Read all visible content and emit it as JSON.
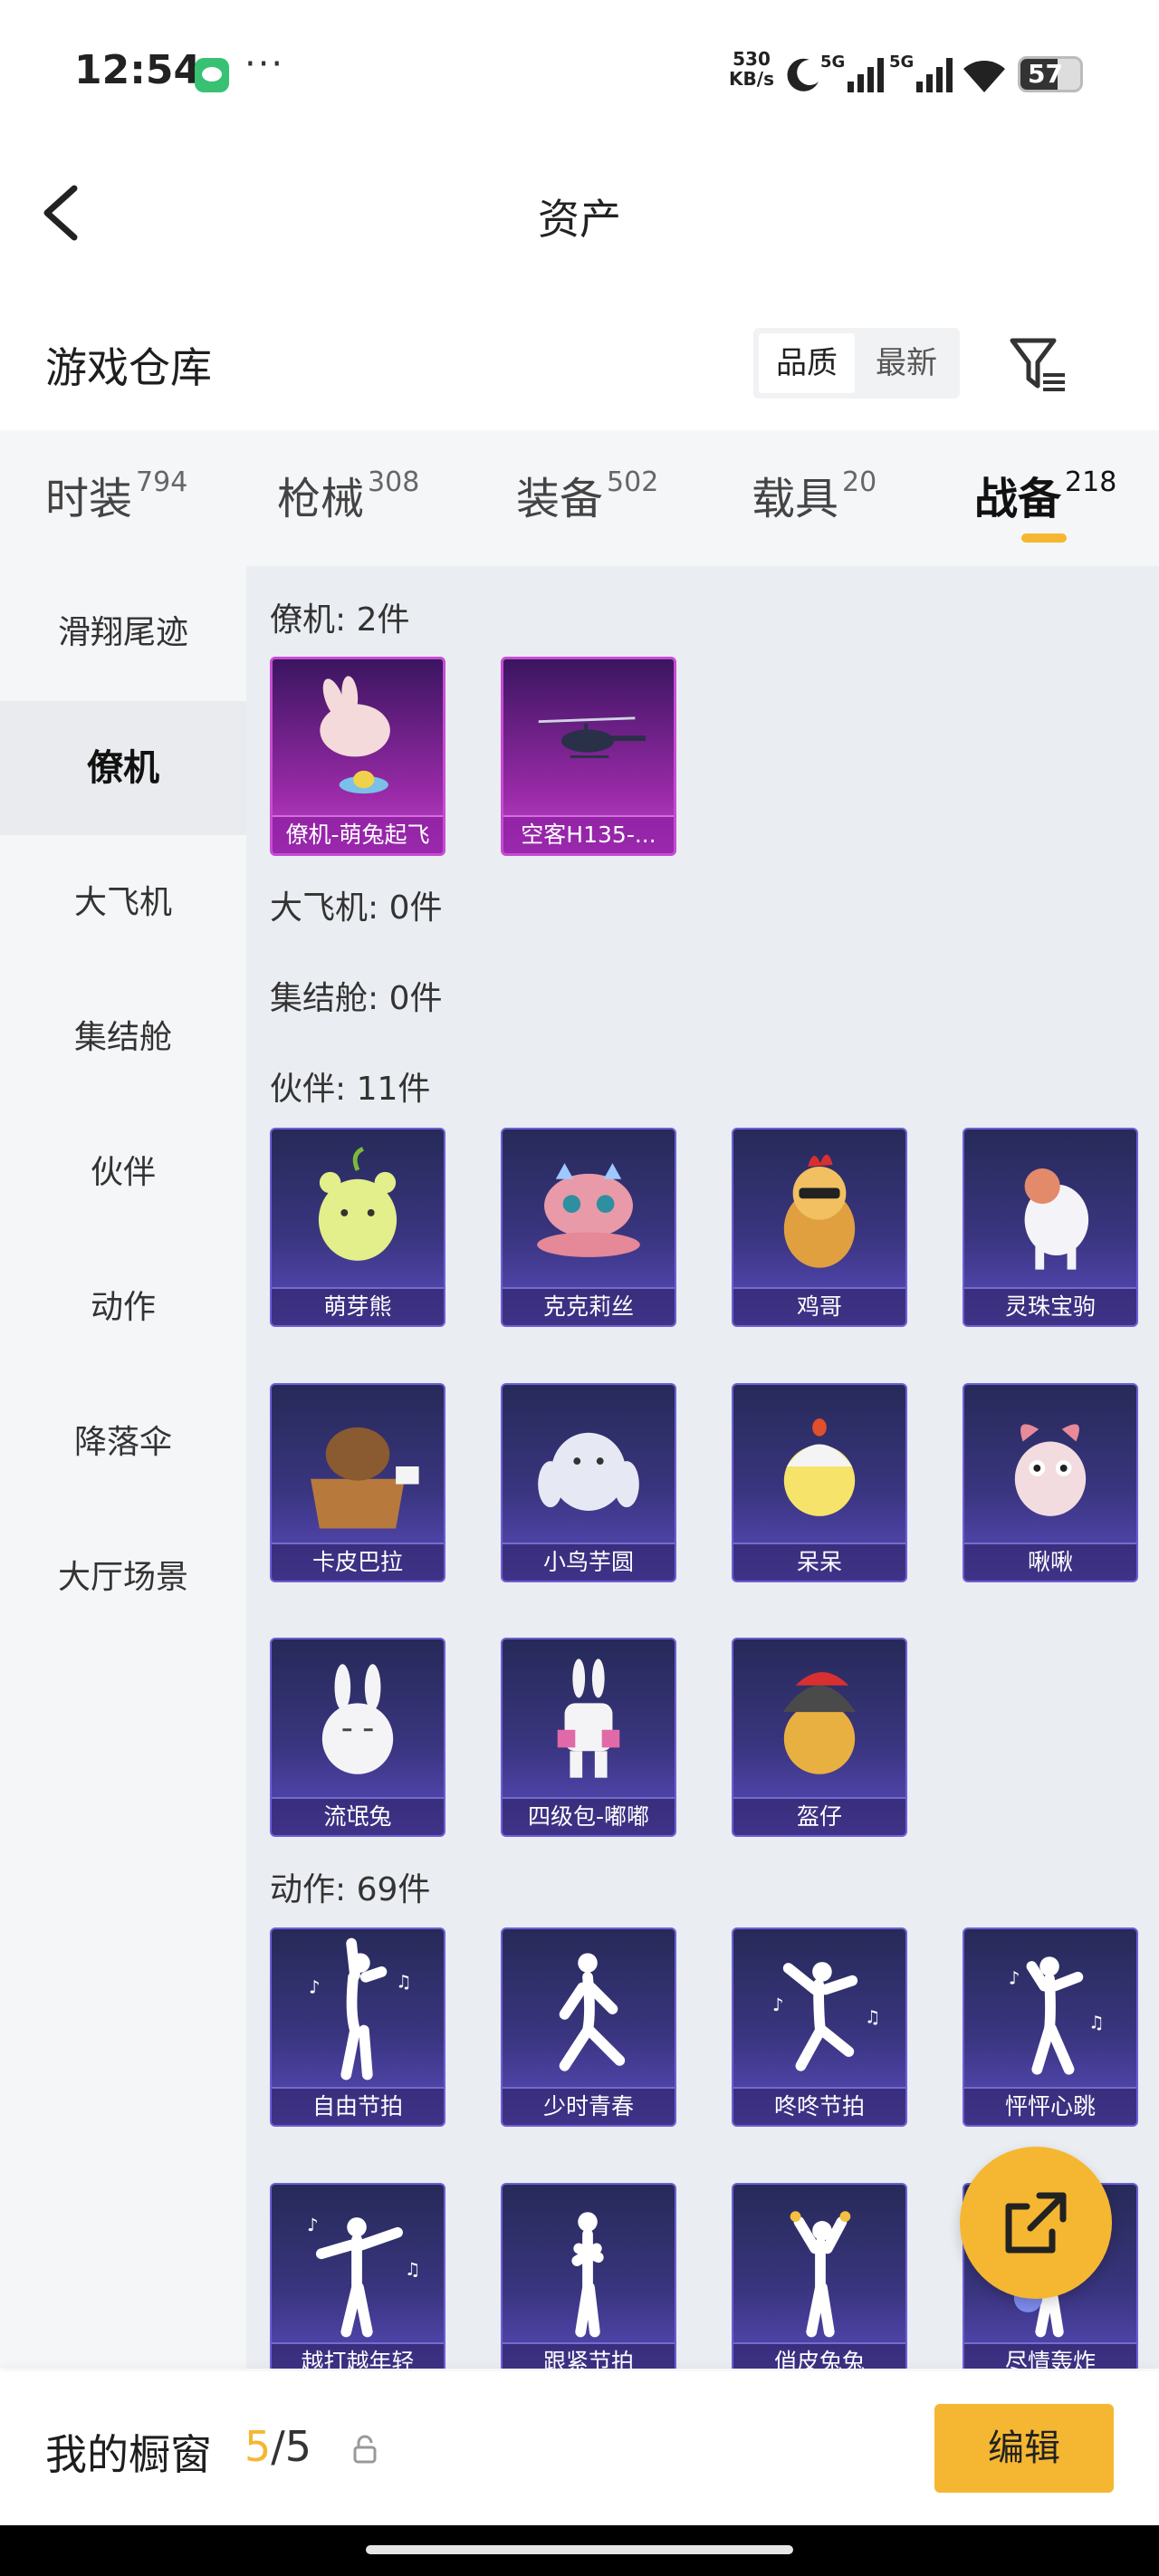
{
  "status_bar": {
    "time": "12:54",
    "speed_value": "530",
    "speed_unit": "KB/s",
    "network1": "5G",
    "network2": "5G",
    "battery": "57"
  },
  "header": {
    "title": "资产"
  },
  "section": {
    "title": "游戏仓库",
    "sort_options": [
      "品质",
      "最新"
    ],
    "sort_selected": "品质"
  },
  "tabs": [
    {
      "label": "时装",
      "count": "794"
    },
    {
      "label": "枪械",
      "count": "308"
    },
    {
      "label": "装备",
      "count": "502"
    },
    {
      "label": "载具",
      "count": "20"
    },
    {
      "label": "战备",
      "count": "218"
    }
  ],
  "active_tab": "战备",
  "sidenav": [
    "滑翔尾迹",
    "僚机",
    "大飞机",
    "集结舱",
    "伙伴",
    "动作",
    "降落伞",
    "大厅场景"
  ],
  "active_sidenav": "僚机",
  "groups": {
    "wingman": {
      "label": "僚机: 2件",
      "items": [
        "僚机-萌兔起飞",
        "空客H135-..."
      ]
    },
    "big_plane": {
      "label": "大飞机: 0件"
    },
    "gather_pod": {
      "label": "集结舱: 0件"
    },
    "partner": {
      "label": "伙伴: 11件",
      "items": [
        "萌芽熊",
        "克克莉丝",
        "鸡哥",
        "灵珠宝驹",
        "卡皮巴拉",
        "小鸟芋圆",
        "呆呆",
        "啾啾",
        "流氓兔",
        "四级包-嘟嘟",
        "盔仔"
      ]
    },
    "action": {
      "label": "动作: 69件",
      "items": [
        "自由节拍",
        "少时青春",
        "咚咚节拍",
        "怦怦心跳",
        "越打越年轻",
        "跟紧节拍",
        "俏皮兔兔",
        "尽情轰炸"
      ]
    }
  },
  "bottom": {
    "showcase_label": "我的橱窗",
    "showcase_current": "5",
    "showcase_total": "/5",
    "edit_label": "编辑"
  },
  "colors": {
    "accent": "#f5b731",
    "card_purple": "#9a2aa8",
    "card_blue": "#3a3580"
  }
}
